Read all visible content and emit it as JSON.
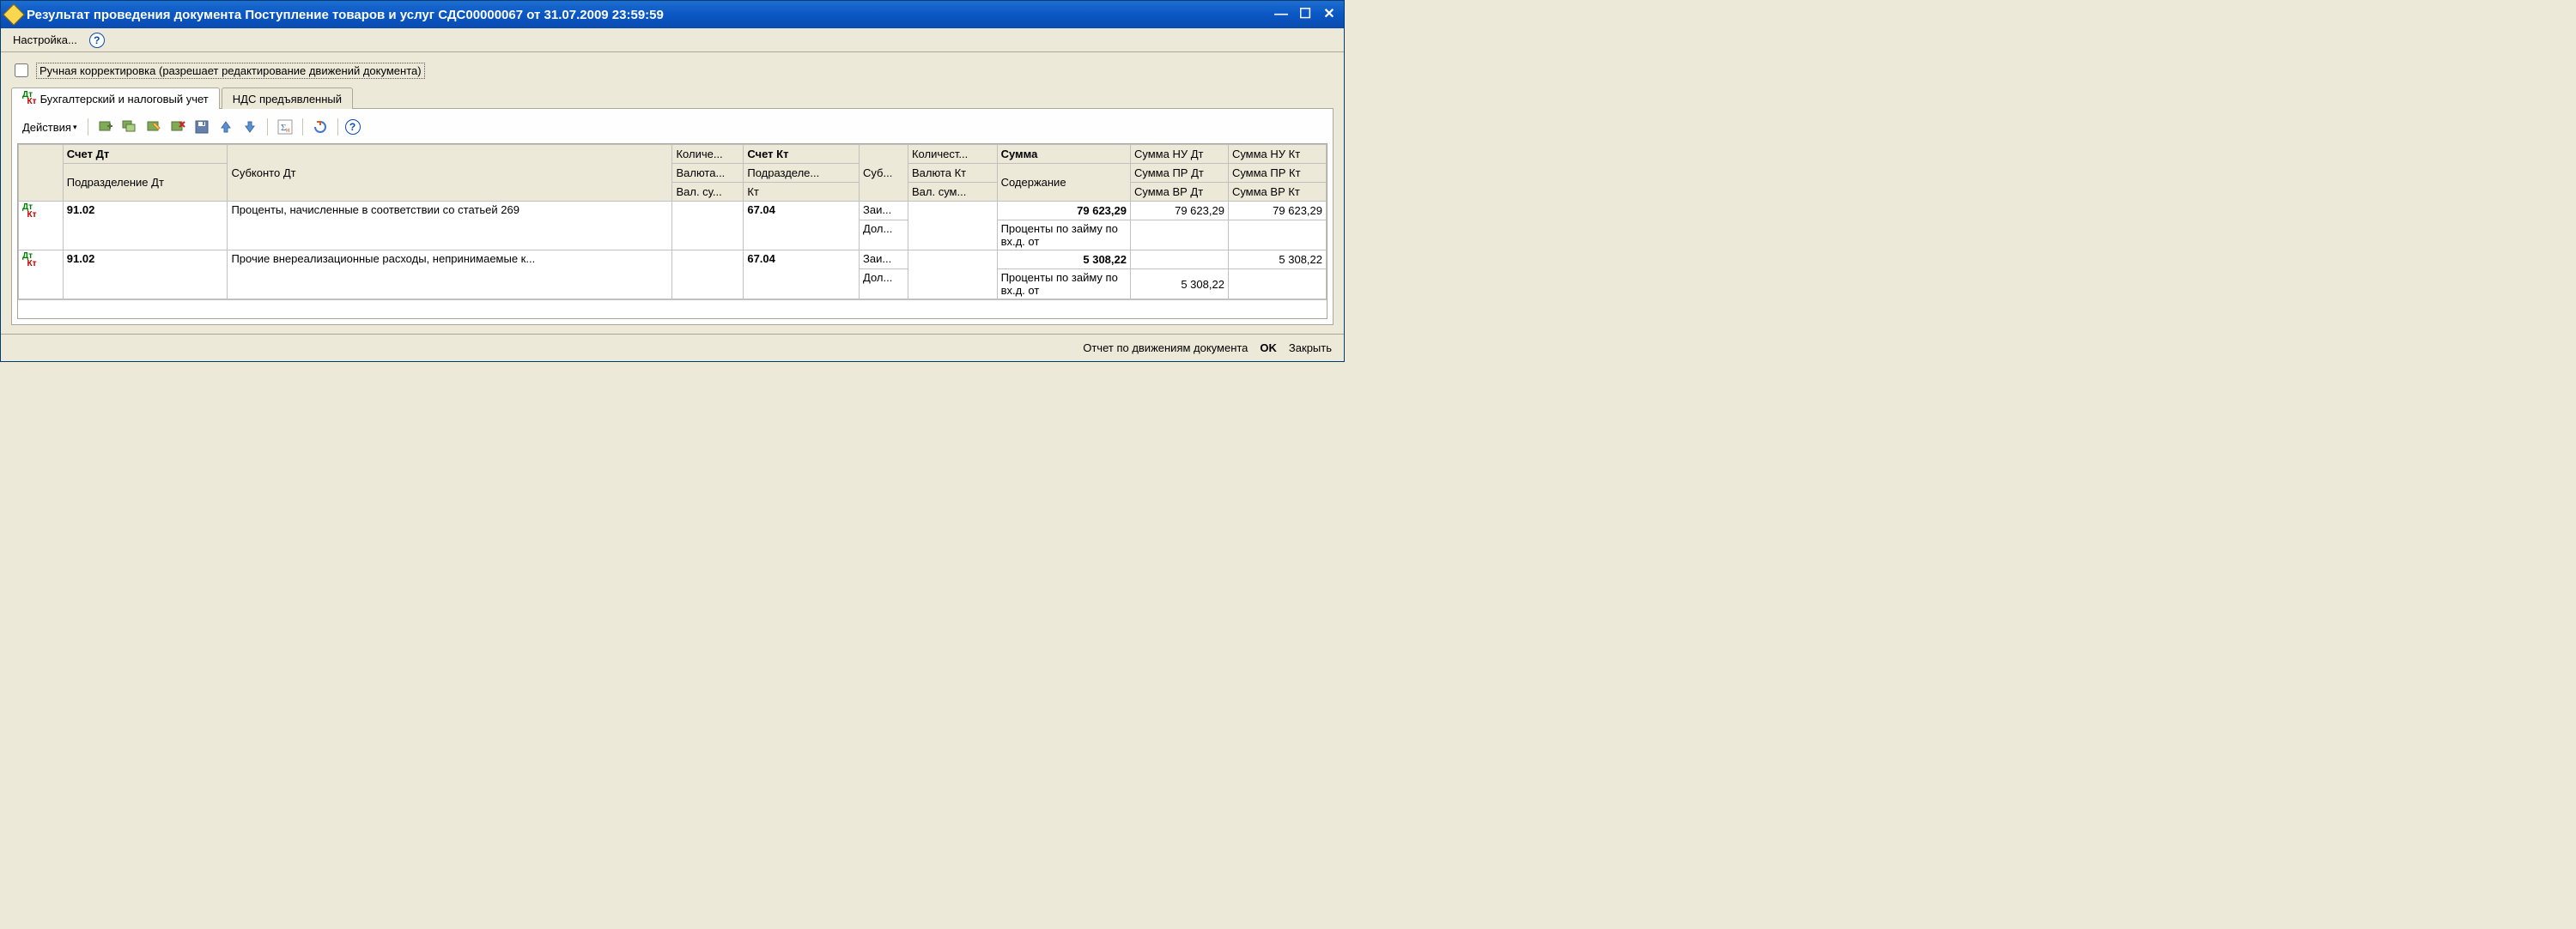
{
  "titlebar": {
    "title": "Результат проведения документа Поступление товаров и услуг СДС00000067 от 31.07.2009 23:59:59"
  },
  "menu": {
    "settings": "Настройка..."
  },
  "checkbox": {
    "label": "Ручная корректировка (разрешает редактирование движений документа)"
  },
  "tabs": {
    "t0": "Бухгалтерский и налоговый учет",
    "t1": "НДС предъявленный"
  },
  "toolbar": {
    "actions": "Действия"
  },
  "headers": {
    "c1a": "Счет Дт",
    "c1b": "Подразделение Дт",
    "c2": "Субконто Дт",
    "c3a": "Количе...",
    "c3b": "Валюта...",
    "c3c": "Вал. су...",
    "c4a": "Счет Кт",
    "c4b": "Подразделе...",
    "c4c": "Кт",
    "c5": "Суб...",
    "c6a": "Количест...",
    "c6b": "Валюта Кт",
    "c6c": "Вал. сум...",
    "c7a": "Сумма",
    "c7b": "Содержание",
    "c8a": "Сумма НУ Дт",
    "c8b": "Сумма ПР Дт",
    "c8c": "Сумма ВР Дт",
    "c9a": "Сумма НУ Кт",
    "c9b": "Сумма ПР Кт",
    "c9c": "Сумма ВР Кт"
  },
  "rows": [
    {
      "acct_dt": "91.02",
      "subconto": "Проценты, начисленные в соответствии со статьей 269",
      "acct_kt": "67.04",
      "sub_kt_1": "Заи...",
      "sub_kt_2": "Дол...",
      "sum": "79 623,29",
      "desc": "Проценты по займу по вх.д. от",
      "nu_dt_1": "79 623,29",
      "nu_dt_2": "",
      "nu_kt_1": "79 623,29",
      "nu_kt_2": ""
    },
    {
      "acct_dt": "91.02",
      "subconto": "Прочие внереализационные расходы, непринимаемые к...",
      "acct_kt": "67.04",
      "sub_kt_1": "Заи...",
      "sub_kt_2": "Дол...",
      "sum": "5 308,22",
      "desc": "Проценты по займу по вх.д. от",
      "nu_dt_1": "",
      "nu_dt_2": "5 308,22",
      "nu_kt_1": "5 308,22",
      "nu_kt_2": ""
    }
  ],
  "status": {
    "report": "Отчет по движениям документа",
    "ok": "OK",
    "close": "Закрыть"
  }
}
